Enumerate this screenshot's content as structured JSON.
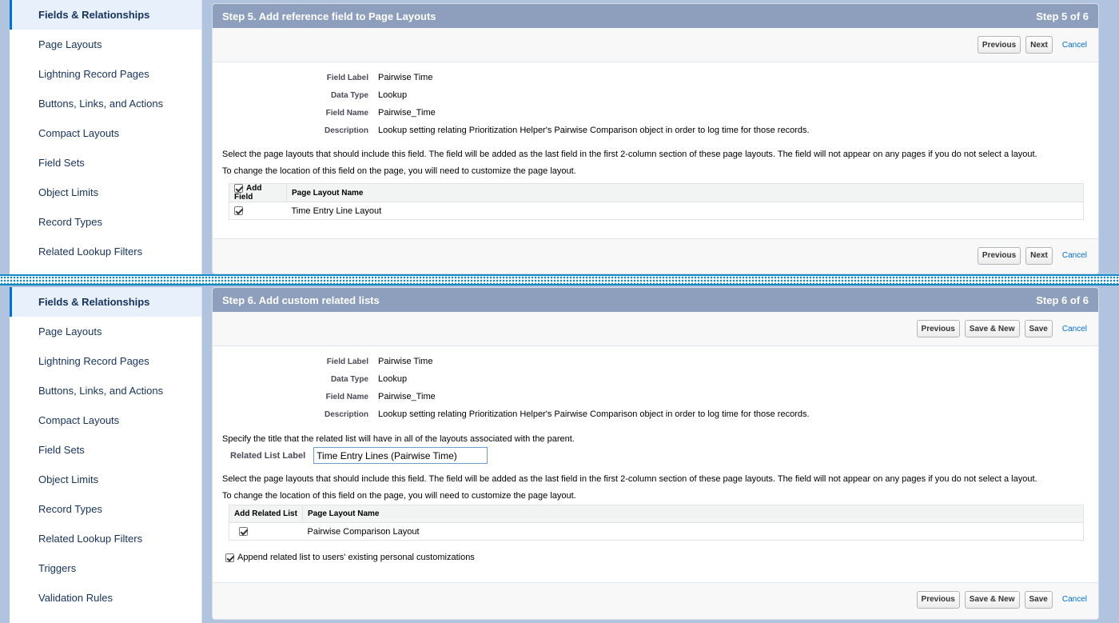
{
  "top": {
    "sidebar": [
      "Fields & Relationships",
      "Page Layouts",
      "Lightning Record Pages",
      "Buttons, Links, and Actions",
      "Compact Layouts",
      "Field Sets",
      "Object Limits",
      "Record Types",
      "Related Lookup Filters"
    ],
    "header_title": "Step 5. Add reference field to Page Layouts",
    "header_step": "Step 5 of 6",
    "btn_previous": "Previous",
    "btn_next": "Next",
    "cancel": "Cancel",
    "info": {
      "field_label_key": "Field Label",
      "field_label_val": "Pairwise Time",
      "data_type_key": "Data Type",
      "data_type_val": "Lookup",
      "field_name_key": "Field Name",
      "field_name_val": "Pairwise_Time",
      "description_key": "Description",
      "description_val": "Lookup setting relating Prioritization Helper's Pairwise Comparison object in order to log time for those records."
    },
    "para1": "Select the page layouts that should include this field. The field will be added as the last field in the first 2-column section of these page layouts. The field will not appear on any pages if you do not select a layout.",
    "para2": "To change the location of this field on the page, you will need to customize the page layout.",
    "table": {
      "col1": "Add Field",
      "col2": "Page Layout Name",
      "row1": "Time Entry Line Layout"
    }
  },
  "bottom": {
    "sidebar": [
      "Fields & Relationships",
      "Page Layouts",
      "Lightning Record Pages",
      "Buttons, Links, and Actions",
      "Compact Layouts",
      "Field Sets",
      "Object Limits",
      "Record Types",
      "Related Lookup Filters",
      "Triggers",
      "Validation Rules"
    ],
    "header_title": "Step 6. Add custom related lists",
    "header_step": "Step 6 of 6",
    "btn_previous": "Previous",
    "btn_save_new": "Save & New",
    "btn_save": "Save",
    "cancel": "Cancel",
    "info": {
      "field_label_key": "Field Label",
      "field_label_val": "Pairwise Time",
      "data_type_key": "Data Type",
      "data_type_val": "Lookup",
      "field_name_key": "Field Name",
      "field_name_val": "Pairwise_Time",
      "description_key": "Description",
      "description_val": "Lookup setting relating Prioritization Helper's Pairwise Comparison object in order to log time for those records."
    },
    "para_title": "Specify the title that the related list will have in all of the layouts associated with the parent.",
    "related_list_label": "Related List Label",
    "related_list_value": "Time Entry Lines (Pairwise Time)",
    "para1": "Select the page layouts that should include this field. The field will be added as the last field in the first 2-column section of these page layouts. The field will not appear on any pages if you do not select a layout.",
    "para2": "To change the location of this field on the page, you will need to customize the page layout.",
    "table": {
      "col1": "Add Related List",
      "col2": "Page Layout Name",
      "row1": "Pairwise Comparison Layout"
    },
    "append_label": "Append related list to users' existing personal customizations"
  }
}
